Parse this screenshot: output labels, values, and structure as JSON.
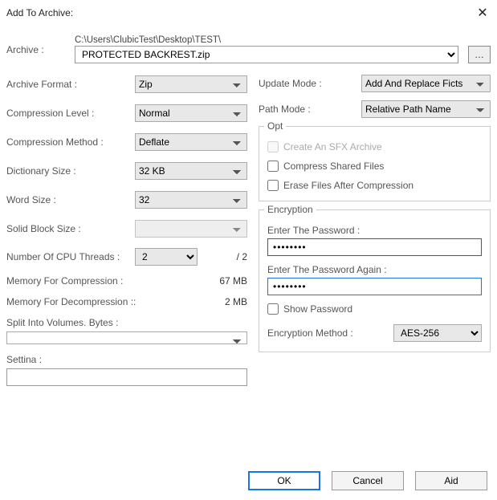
{
  "window": {
    "title": "Add To Archive:"
  },
  "archive": {
    "label": "Archive :",
    "path": "C:\\Users\\ClubicTest\\Desktop\\TEST\\",
    "filename": "PROTECTED BACKREST.zip",
    "browse": "…"
  },
  "left": {
    "format": {
      "label": "Archive Format :",
      "value": "Zip"
    },
    "compressionLevel": {
      "label": "Compression Level :",
      "value": "Normal"
    },
    "compressionMethod": {
      "label": "Compression Method :",
      "value": "Deflate"
    },
    "dictionarySize": {
      "label": "Dictionary Size :",
      "value": "32 KB"
    },
    "wordSize": {
      "label": "Word Size :",
      "value": "32"
    },
    "solidBlockSize": {
      "label": "Solid Block Size :",
      "value": ""
    },
    "cpuThreads": {
      "label": "Number Of CPU Threads :",
      "value": "2",
      "max": "/ 2"
    },
    "memCompression": {
      "label": "Memory For Compression :",
      "value": "67 MB"
    },
    "memDecompression": {
      "label": "Memory For Decompression ::",
      "value": "2 MB"
    },
    "splitVolumes": {
      "label": "Split Into Volumes. Bytes :",
      "value": ""
    },
    "settings": {
      "label": "Settina :",
      "value": ""
    }
  },
  "right": {
    "updateMode": {
      "label": "Update Mode :",
      "value": "Add And Replace Ficts"
    },
    "pathMode": {
      "label": "Path Mode :",
      "value": "Relative Path Name"
    },
    "options": {
      "title": "Opt",
      "sfx": "Create An SFX Archive",
      "sharedFiles": "Compress Shared Files",
      "eraseAfter": "Erase Files After Compression"
    },
    "encryption": {
      "title": "Encryption",
      "enterPassword": "Enter The Password :",
      "reenterPassword": "Enter The Password Again :",
      "passwordValue": "••••••••",
      "showPassword": "Show Password",
      "methodLabel": "Encryption Method :",
      "methodValue": "AES-256"
    }
  },
  "buttons": {
    "ok": "OK",
    "cancel": "Cancel",
    "aid": "Aid"
  }
}
